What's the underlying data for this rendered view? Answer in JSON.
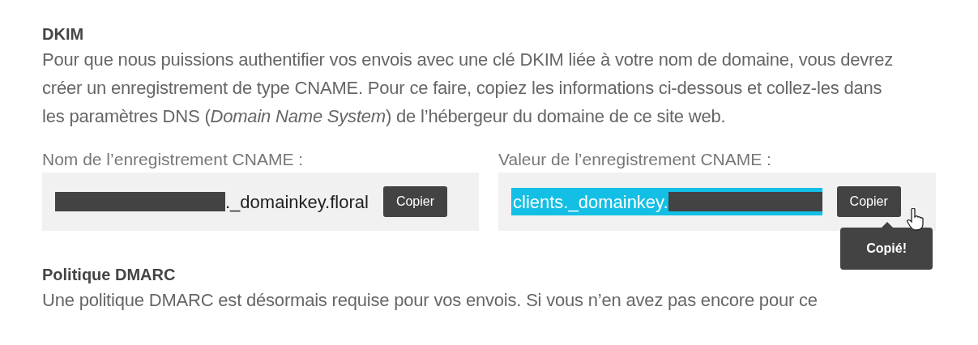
{
  "sections": [
    {
      "title": "DKIM",
      "paragraph": "Pour que nous puissions authentifier vos envois avec une clé DKIM liée à votre nom de domaine, vous devrez créer un enregistrement de type CNAME. Pour ce faire, copiez les informations ci-dessous et collez-les dans les paramètres DNS (*Domain Name System*) de l’hébergeur du domaine de ce site web.",
      "fields": [
        {
          "label": "Nom de l’enregistrement CNAME :",
          "parts": [
            {
              "kind": "redacted"
            },
            {
              "kind": "text",
              "text": "._domainkey.floral"
            }
          ],
          "selected": false,
          "button": "Copier"
        },
        {
          "label": "Valeur de l’enregistrement CNAME :",
          "parts": [
            {
              "kind": "text",
              "text": "clients._domainkey."
            },
            {
              "kind": "redacted"
            }
          ],
          "selected": true,
          "button": "Copier",
          "tooltip": "Copié!"
        }
      ]
    },
    {
      "title": "Politique DMARC",
      "paragraph": "Une politique DMARC est désormais requise pour vos envois. Si vous n’en avez pas encore pour ce"
    }
  ]
}
